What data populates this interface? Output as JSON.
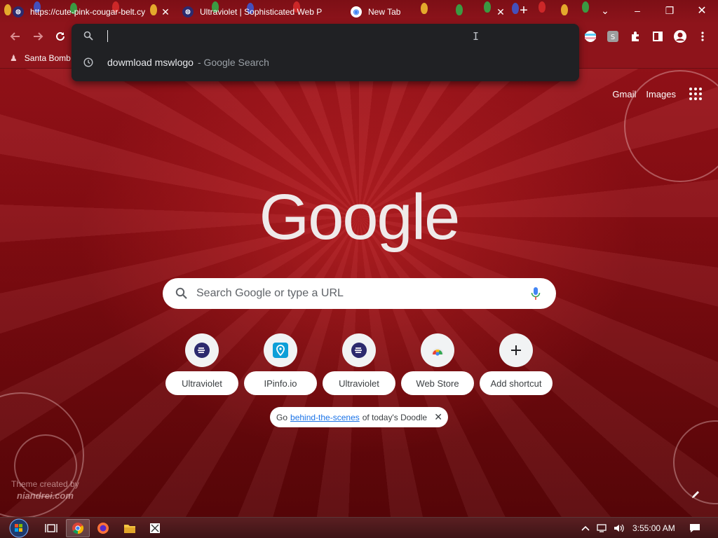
{
  "tabs": [
    {
      "label": "https://cute-pink-cougar-belt.cy",
      "favicon": "ultraviolet-icon"
    },
    {
      "label": "Ultraviolet | Sophisticated Web P",
      "favicon": "ultraviolet-icon"
    },
    {
      "label": "New Tab",
      "favicon": "chrome-icon"
    }
  ],
  "new_tab_symbol": "+",
  "window_controls": {
    "minimize": "–",
    "maximize": "❐",
    "close": "✕"
  },
  "bookmarks": [
    {
      "label": "Santa Bomb"
    }
  ],
  "omnibox": {
    "value": "",
    "suggestion": {
      "query": "dowmload mswlogo",
      "source": "- Google Search"
    }
  },
  "ntp": {
    "links": {
      "gmail": "Gmail",
      "images": "Images"
    },
    "logo": "Google",
    "search_placeholder": "Search Google or type a URL",
    "shortcuts": [
      {
        "label": "Ultraviolet",
        "icon": "ultraviolet-icon"
      },
      {
        "label": "IPinfo.io",
        "icon": "ipinfo-icon"
      },
      {
        "label": "Ultraviolet",
        "icon": "ultraviolet-icon"
      },
      {
        "label": "Web Store",
        "icon": "webstore-icon"
      },
      {
        "label": "Add shortcut",
        "icon": "plus-icon"
      }
    ],
    "doodle": {
      "prefix": "Go",
      "link": "behind-the-scenes",
      "suffix": "of today's Doodle"
    },
    "attribution": {
      "line1": "Theme created by",
      "author": "niandrei.com"
    }
  },
  "taskbar": {
    "clock": "3:55:00 AM"
  },
  "colors": {
    "theme_red": "#8e141b",
    "omnibox_bg": "#202124",
    "link_blue": "#1a73e8"
  }
}
